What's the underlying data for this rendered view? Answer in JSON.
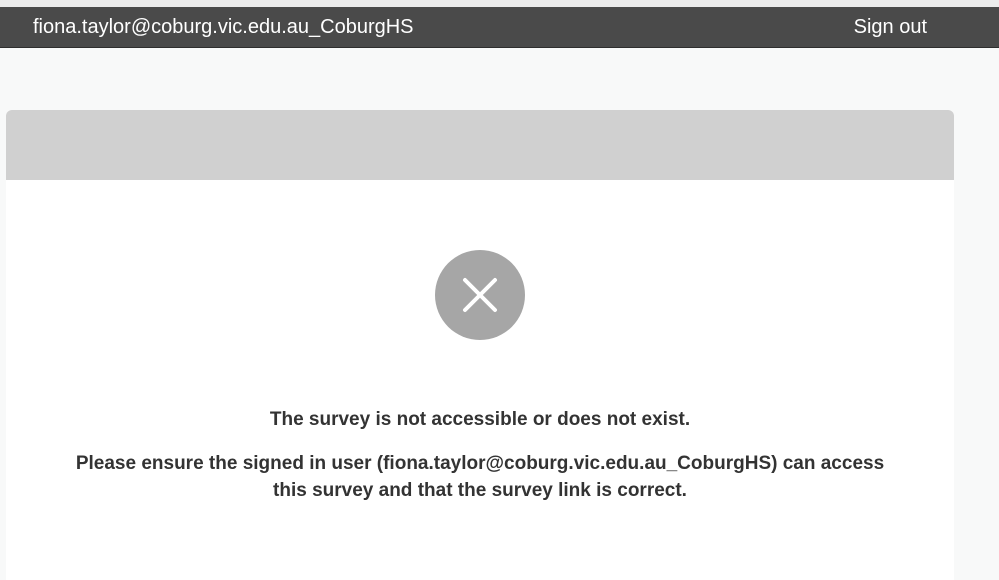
{
  "header": {
    "user": "fiona.taylor@coburg.vic.edu.au_CoburgHS",
    "sign_out_label": "Sign out"
  },
  "error": {
    "icon": "close-icon",
    "title": "The survey is not accessible or does not exist.",
    "message_line1": "Please ensure the signed in user (fiona.taylor@coburg.vic.edu.au_CoburgHS) can access",
    "message_line2": "this survey and that the survey link is correct."
  },
  "colors": {
    "header_bg": "#4a4a4a",
    "card_header_bg": "#d0d0d0",
    "icon_circle": "#a6a6a6",
    "text": "#333333"
  }
}
